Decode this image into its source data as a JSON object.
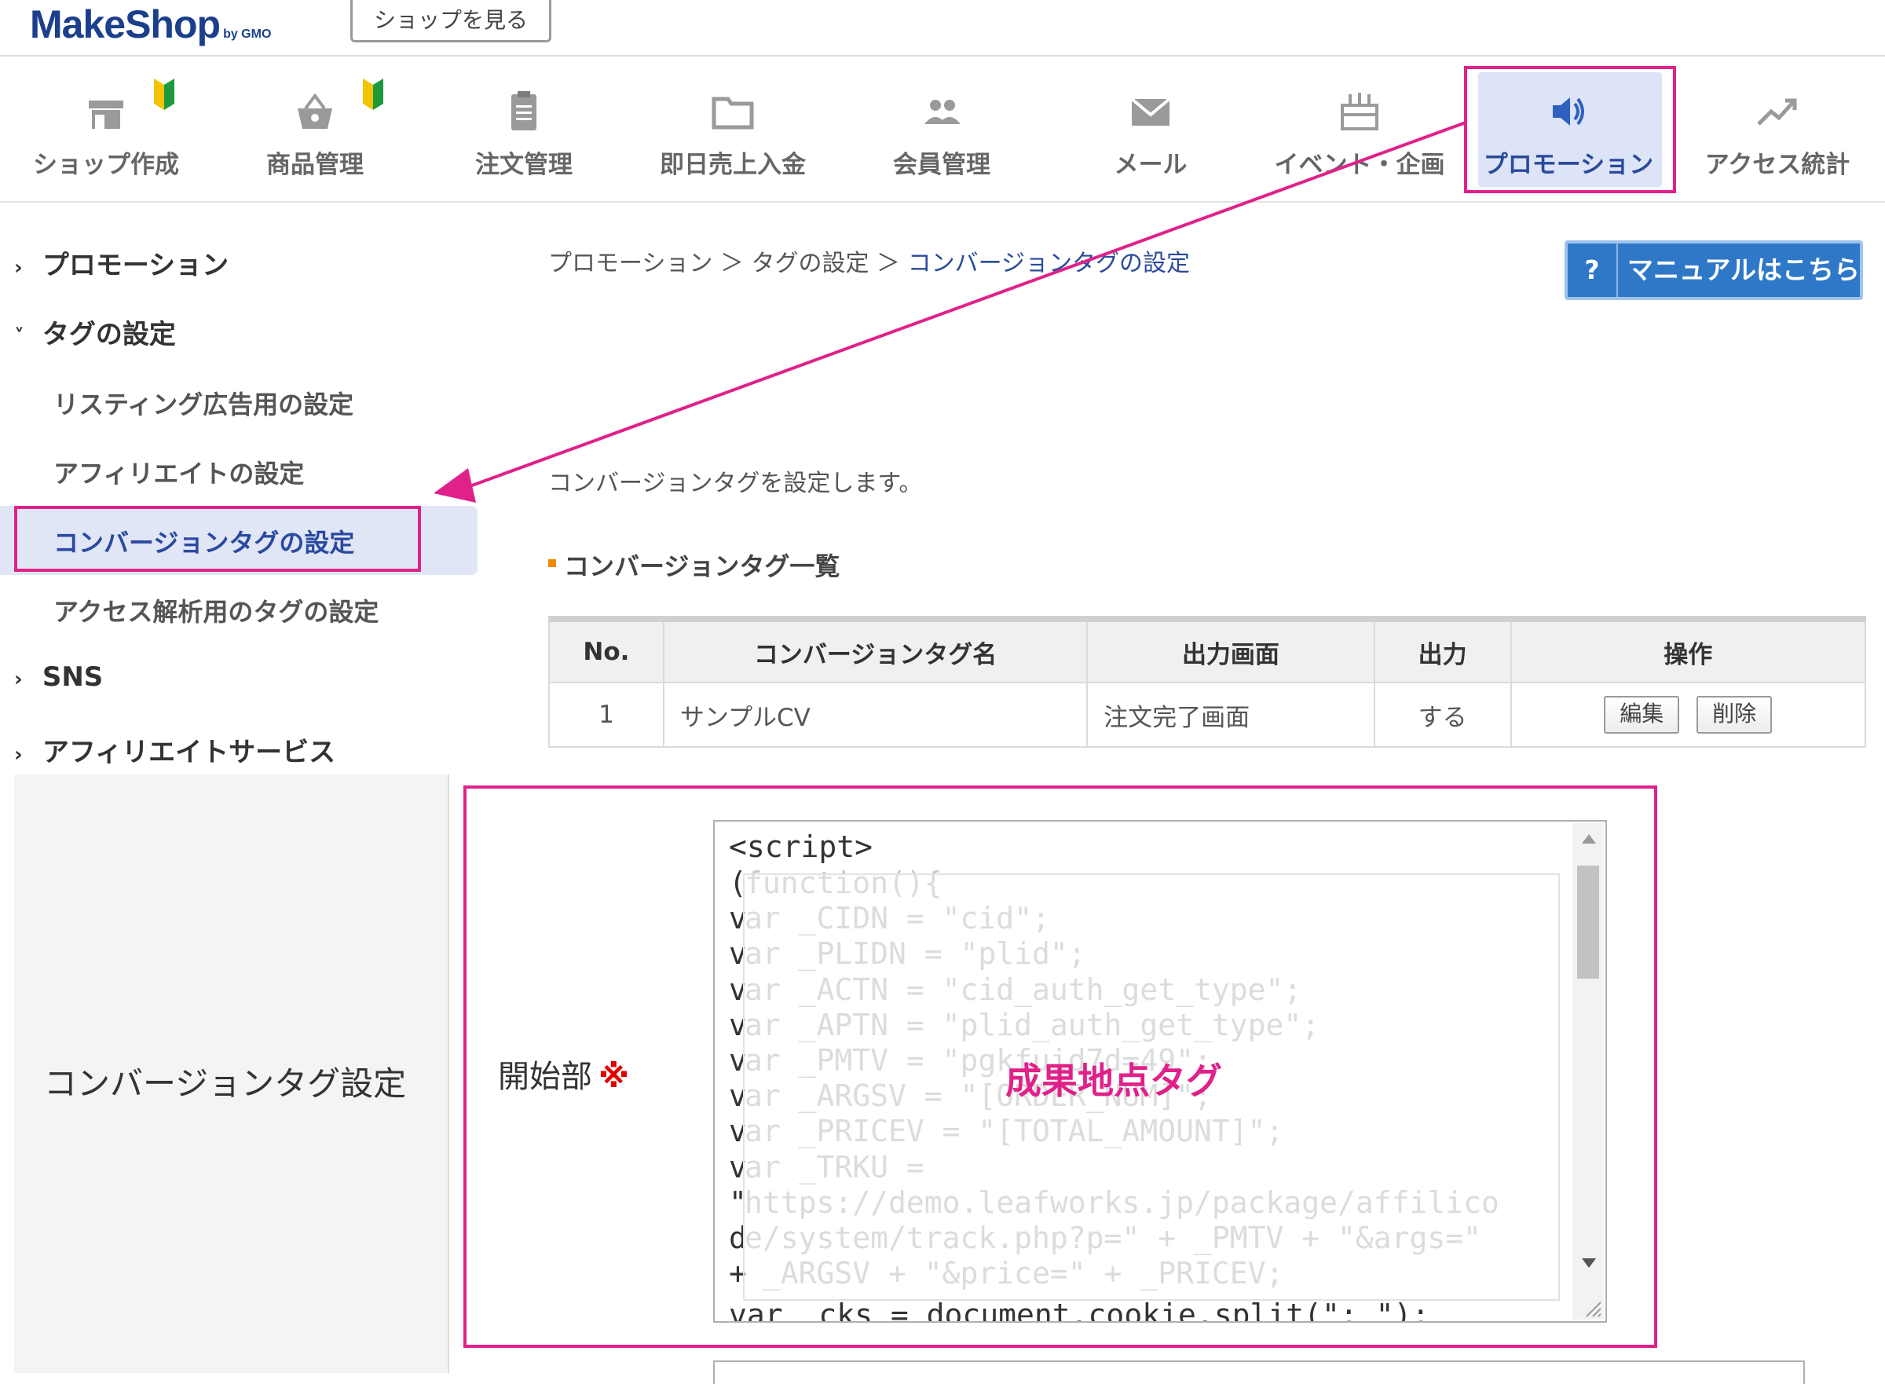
{
  "header": {
    "logo_text": "MakeShop",
    "logo_sub": "by GMO",
    "shop_button": "ショップを見る"
  },
  "main_nav": {
    "items": [
      {
        "label": "ショップ作成",
        "icon": "shop-icon"
      },
      {
        "label": "商品管理",
        "icon": "basket-icon"
      },
      {
        "label": "注文管理",
        "icon": "clipboard-icon"
      },
      {
        "label": "即日売上入金",
        "icon": "folder-icon"
      },
      {
        "label": "会員管理",
        "icon": "members-icon"
      },
      {
        "label": "メール",
        "icon": "mail-icon"
      },
      {
        "label": "イベント・企画",
        "icon": "gift-icon"
      },
      {
        "label": "プロモーション",
        "icon": "megaphone-icon",
        "active": true
      },
      {
        "label": "アクセス統計",
        "icon": "trend-icon"
      }
    ]
  },
  "sidebar": {
    "sections": [
      {
        "label": "プロモーション",
        "expanded": false
      },
      {
        "label": "タグの設定",
        "expanded": true
      },
      {
        "label": "SNS",
        "expanded": false
      },
      {
        "label": "アフィリエイトサービス",
        "expanded": false
      }
    ],
    "tag_items": [
      {
        "label": "リスティング広告用の設定"
      },
      {
        "label": "アフィリエイトの設定"
      },
      {
        "label": "コンバージョンタグの設定",
        "active": true
      },
      {
        "label": "アクセス解析用のタグの設定"
      }
    ]
  },
  "content": {
    "breadcrumb": [
      "プロモーション",
      "タグの設定",
      "コンバージョンタグの設定"
    ],
    "breadcrumb_sep": "＞",
    "manual_button": "マニュアルはこちら",
    "manual_icon_text": "?",
    "description": "コンバージョンタグを設定します。",
    "list_title": "コンバージョンタグ一覧",
    "table": {
      "headers": [
        "No.",
        "コンバージョンタグ名",
        "出力画面",
        "出力",
        "操作"
      ],
      "rows": [
        {
          "no": "1",
          "name": "サンプルCV",
          "screen": "注文完了画面",
          "output": "する",
          "edit": "編集",
          "delete": "削除"
        }
      ]
    }
  },
  "form": {
    "section_label": "コンバージョンタグ設定",
    "field_label": "開始部",
    "required_mark": "※",
    "code_first_line": "<script>",
    "code_gutter": "(\nv\nv\nv\nv\nv\nv\nv\nv\n\"\nd\n+",
    "code_faded": "function(){\nar _CIDN = \"cid\";\nar _PLIDN = \"plid\";\nar _ACTN = \"cid_auth_get_type\";\nar _APTN = \"plid_auth_get_type\";\nar _PMTV = \"pgkfuid7d=49\";\nar _ARGSV = \"[ORDER_NUM]\";\nar _PRICEV = \"[TOTAL_AMOUNT]\";\nar _TRKU =\nhttps://demo.leafworks.jp/package/affilico\ne/system/track.php?p=\" + _PMTV + \"&args=\"\n _ARGSV + \"&price=\" + _PRICEV;",
    "code_last_line": "var _cks = document.cookie.split(\"; \");",
    "annotation": "成果地点タグ"
  },
  "colors": {
    "highlight": "#e0218a",
    "brand": "#1b3f8b",
    "active_bg": "#dde4f7",
    "manual_button": "#2f78c8",
    "required": "#e00000"
  }
}
